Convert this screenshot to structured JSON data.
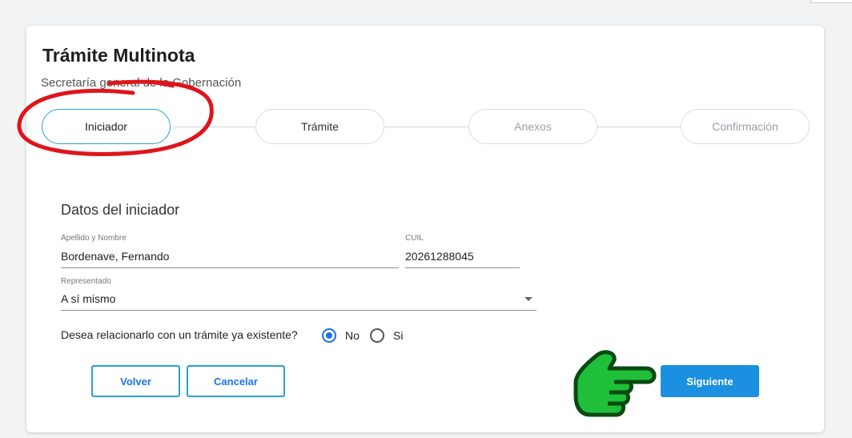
{
  "card": {
    "title": "Trámite Multinota",
    "subtitle": "Secretaría general de la Gobernación"
  },
  "stepper": {
    "steps": [
      {
        "label": "Iniciador",
        "state": "active"
      },
      {
        "label": "Trámite",
        "state": "normal"
      },
      {
        "label": "Anexos",
        "state": "disabled"
      },
      {
        "label": "Confirmación",
        "state": "disabled"
      }
    ]
  },
  "form": {
    "section_title": "Datos del iniciador",
    "nombre_label": "Apellido y Nombre",
    "nombre_value": "Bordenave, Fernando",
    "cuil_label": "CUIL",
    "cuil_value": "20261288045",
    "representado_label": "Representado",
    "representado_value": "A sí mismo",
    "question": "Desea relacionarlo con un trámite ya existente?",
    "radio_no": "No",
    "radio_si": "Si",
    "radio_selected": "No"
  },
  "buttons": {
    "volver": "Volver",
    "cancelar": "Cancelar",
    "siguiente": "Siguiente"
  },
  "colors": {
    "accent": "#2b9ed8",
    "primary": "#1b8fe0",
    "annotation": "#e0141b",
    "hand": "#1fbf3a"
  },
  "icons": {
    "hand": "pointing-hand-icon",
    "caret": "chevron-down-icon"
  }
}
